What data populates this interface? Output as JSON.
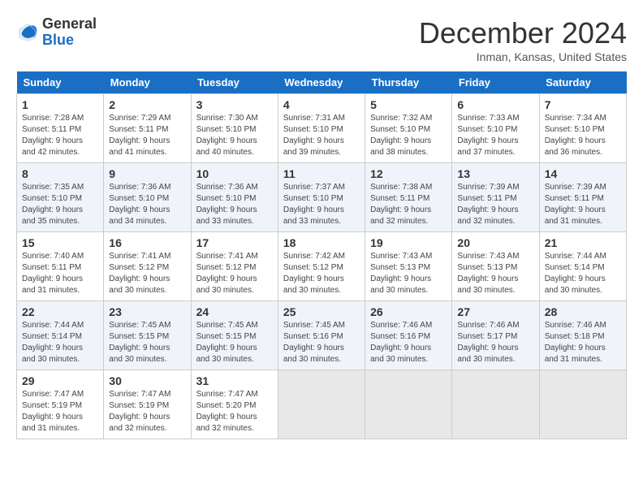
{
  "app": {
    "name": "GeneralBlue",
    "logo_text_normal": "General",
    "logo_text_blue": "Blue"
  },
  "title": {
    "month": "December 2024",
    "location": "Inman, Kansas, United States"
  },
  "days_of_week": [
    "Sunday",
    "Monday",
    "Tuesday",
    "Wednesday",
    "Thursday",
    "Friday",
    "Saturday"
  ],
  "weeks": [
    [
      {
        "day": "1",
        "sunrise": "7:28 AM",
        "sunset": "5:11 PM",
        "daylight": "9 hours and 42 minutes."
      },
      {
        "day": "2",
        "sunrise": "7:29 AM",
        "sunset": "5:11 PM",
        "daylight": "9 hours and 41 minutes."
      },
      {
        "day": "3",
        "sunrise": "7:30 AM",
        "sunset": "5:10 PM",
        "daylight": "9 hours and 40 minutes."
      },
      {
        "day": "4",
        "sunrise": "7:31 AM",
        "sunset": "5:10 PM",
        "daylight": "9 hours and 39 minutes."
      },
      {
        "day": "5",
        "sunrise": "7:32 AM",
        "sunset": "5:10 PM",
        "daylight": "9 hours and 38 minutes."
      },
      {
        "day": "6",
        "sunrise": "7:33 AM",
        "sunset": "5:10 PM",
        "daylight": "9 hours and 37 minutes."
      },
      {
        "day": "7",
        "sunrise": "7:34 AM",
        "sunset": "5:10 PM",
        "daylight": "9 hours and 36 minutes."
      }
    ],
    [
      {
        "day": "8",
        "sunrise": "7:35 AM",
        "sunset": "5:10 PM",
        "daylight": "9 hours and 35 minutes."
      },
      {
        "day": "9",
        "sunrise": "7:36 AM",
        "sunset": "5:10 PM",
        "daylight": "9 hours and 34 minutes."
      },
      {
        "day": "10",
        "sunrise": "7:36 AM",
        "sunset": "5:10 PM",
        "daylight": "9 hours and 33 minutes."
      },
      {
        "day": "11",
        "sunrise": "7:37 AM",
        "sunset": "5:10 PM",
        "daylight": "9 hours and 33 minutes."
      },
      {
        "day": "12",
        "sunrise": "7:38 AM",
        "sunset": "5:11 PM",
        "daylight": "9 hours and 32 minutes."
      },
      {
        "day": "13",
        "sunrise": "7:39 AM",
        "sunset": "5:11 PM",
        "daylight": "9 hours and 32 minutes."
      },
      {
        "day": "14",
        "sunrise": "7:39 AM",
        "sunset": "5:11 PM",
        "daylight": "9 hours and 31 minutes."
      }
    ],
    [
      {
        "day": "15",
        "sunrise": "7:40 AM",
        "sunset": "5:11 PM",
        "daylight": "9 hours and 31 minutes."
      },
      {
        "day": "16",
        "sunrise": "7:41 AM",
        "sunset": "5:12 PM",
        "daylight": "9 hours and 30 minutes."
      },
      {
        "day": "17",
        "sunrise": "7:41 AM",
        "sunset": "5:12 PM",
        "daylight": "9 hours and 30 minutes."
      },
      {
        "day": "18",
        "sunrise": "7:42 AM",
        "sunset": "5:12 PM",
        "daylight": "9 hours and 30 minutes."
      },
      {
        "day": "19",
        "sunrise": "7:43 AM",
        "sunset": "5:13 PM",
        "daylight": "9 hours and 30 minutes."
      },
      {
        "day": "20",
        "sunrise": "7:43 AM",
        "sunset": "5:13 PM",
        "daylight": "9 hours and 30 minutes."
      },
      {
        "day": "21",
        "sunrise": "7:44 AM",
        "sunset": "5:14 PM",
        "daylight": "9 hours and 30 minutes."
      }
    ],
    [
      {
        "day": "22",
        "sunrise": "7:44 AM",
        "sunset": "5:14 PM",
        "daylight": "9 hours and 30 minutes."
      },
      {
        "day": "23",
        "sunrise": "7:45 AM",
        "sunset": "5:15 PM",
        "daylight": "9 hours and 30 minutes."
      },
      {
        "day": "24",
        "sunrise": "7:45 AM",
        "sunset": "5:15 PM",
        "daylight": "9 hours and 30 minutes."
      },
      {
        "day": "25",
        "sunrise": "7:45 AM",
        "sunset": "5:16 PM",
        "daylight": "9 hours and 30 minutes."
      },
      {
        "day": "26",
        "sunrise": "7:46 AM",
        "sunset": "5:16 PM",
        "daylight": "9 hours and 30 minutes."
      },
      {
        "day": "27",
        "sunrise": "7:46 AM",
        "sunset": "5:17 PM",
        "daylight": "9 hours and 30 minutes."
      },
      {
        "day": "28",
        "sunrise": "7:46 AM",
        "sunset": "5:18 PM",
        "daylight": "9 hours and 31 minutes."
      }
    ],
    [
      {
        "day": "29",
        "sunrise": "7:47 AM",
        "sunset": "5:19 PM",
        "daylight": "9 hours and 31 minutes."
      },
      {
        "day": "30",
        "sunrise": "7:47 AM",
        "sunset": "5:19 PM",
        "daylight": "9 hours and 32 minutes."
      },
      {
        "day": "31",
        "sunrise": "7:47 AM",
        "sunset": "5:20 PM",
        "daylight": "9 hours and 32 minutes."
      },
      null,
      null,
      null,
      null
    ]
  ]
}
